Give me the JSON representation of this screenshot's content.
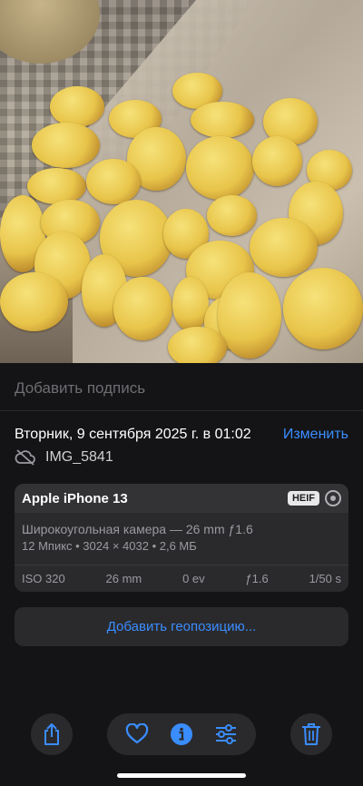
{
  "photo": {
    "icon": "fried-potatoes-photo"
  },
  "caption": {
    "placeholder": "Добавить подпись"
  },
  "meta": {
    "date": "Вторник, 9 сентября 2025 г. в 01:02",
    "edit_label": "Изменить",
    "filename": "IMG_5841"
  },
  "camera": {
    "device": "Apple iPhone 13",
    "format_badge": "HEIF",
    "lens": "Широкоугольная камера — 26 mm ƒ1.6",
    "specs": "12 Мпикс • 3024 × 4032 • 2,6 МБ",
    "exif": [
      "ISO 320",
      "26 mm",
      "0 ev",
      "ƒ1.6",
      "1/50 s"
    ]
  },
  "location": {
    "add_label": "Добавить геопозицию..."
  },
  "colors": {
    "accent": "#3a8dff",
    "background": "#141416",
    "card": "#2a2a2d"
  }
}
